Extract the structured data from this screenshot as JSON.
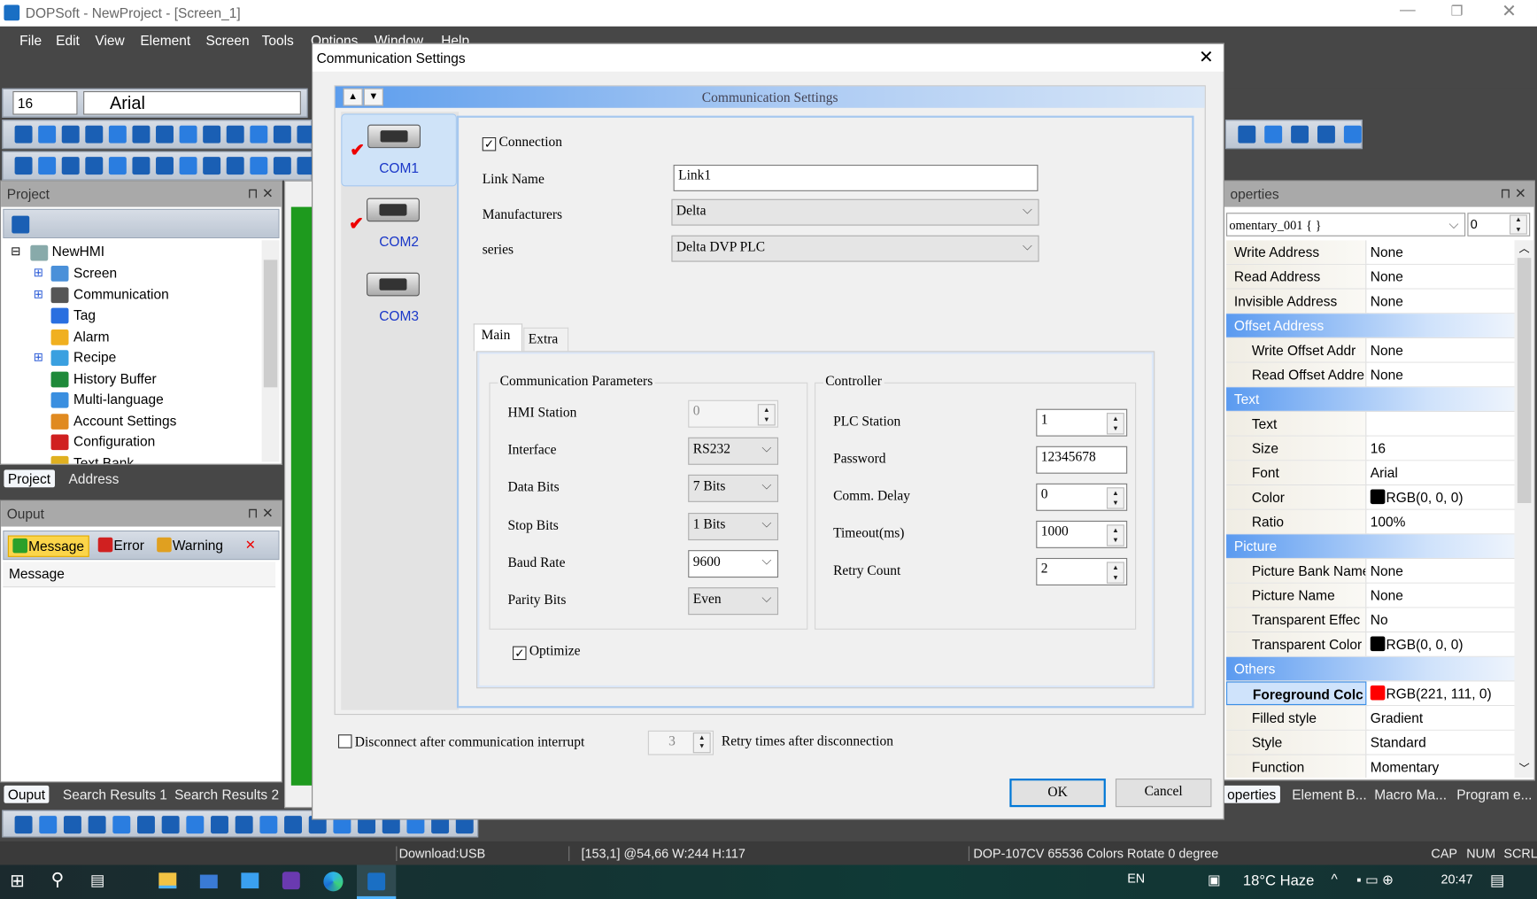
{
  "app": {
    "title": "DOPSoft - NewProject - [Screen_1]",
    "window_controls": [
      "minimize",
      "restore",
      "close"
    ]
  },
  "menu": [
    "File",
    "Edit",
    "View",
    "Element",
    "Screen",
    "Tools",
    "Options",
    "Window",
    "Help"
  ],
  "font_toolbar": {
    "size": "16",
    "font": "Arial"
  },
  "project_panel": {
    "title": "Project",
    "tree_root": "NewHMI",
    "tree": [
      {
        "label": "Screen",
        "expandable": true,
        "icon": "screen-icon",
        "color": "#4a90d9"
      },
      {
        "label": "Communication",
        "expandable": true,
        "icon": "communication-icon",
        "color": "#555555"
      },
      {
        "label": "Tag",
        "expandable": false,
        "icon": "tag-icon",
        "color": "#2a6fe0"
      },
      {
        "label": "Alarm",
        "expandable": false,
        "icon": "alarm-icon",
        "color": "#f0b020"
      },
      {
        "label": "Recipe",
        "expandable": true,
        "icon": "recipe-icon",
        "color": "#3aa0e0"
      },
      {
        "label": "History Buffer",
        "expandable": false,
        "icon": "history-buffer-icon",
        "color": "#1e8a3a"
      },
      {
        "label": "Multi-language",
        "expandable": false,
        "icon": "globe-icon",
        "color": "#3a8fe0"
      },
      {
        "label": "Account Settings",
        "expandable": false,
        "icon": "users-icon",
        "color": "#e08a20"
      },
      {
        "label": "Configuration",
        "expandable": false,
        "icon": "tools-icon",
        "color": "#d02020"
      },
      {
        "label": "Text Bank",
        "expandable": false,
        "icon": "text-bank-icon",
        "color": "#e0b020"
      }
    ],
    "tabs": [
      "Project",
      "Address"
    ]
  },
  "output_panel": {
    "title": "Ouput",
    "filters": [
      "Message",
      "Error",
      "Warning"
    ],
    "column": "Message",
    "tabs": [
      "Ouput",
      "Search Results 1",
      "Search Results 2"
    ]
  },
  "dialog": {
    "title": "Communication Settings",
    "header": "Communication Settings",
    "ports": [
      {
        "name": "COM1",
        "checked": true,
        "selected": true
      },
      {
        "name": "COM2",
        "checked": true,
        "selected": false
      },
      {
        "name": "COM3",
        "checked": false,
        "selected": false
      }
    ],
    "connection_label": "Connection",
    "connection_checked": true,
    "link_name_label": "Link Name",
    "link_name": "Link1",
    "manufacturers_label": "Manufacturers",
    "manufacturer": "Delta",
    "series_label": "series",
    "series": "Delta DVP PLC",
    "tabs": [
      "Main",
      "Extra"
    ],
    "active_tab": "Main",
    "comm_params": {
      "legend": "Communication Parameters",
      "rows": [
        {
          "label": "HMI Station",
          "value": "0",
          "kind": "spin-disabled"
        },
        {
          "label": "Interface",
          "value": "RS232",
          "kind": "select"
        },
        {
          "label": "Data Bits",
          "value": "7 Bits",
          "kind": "select"
        },
        {
          "label": "Stop Bits",
          "value": "1 Bits",
          "kind": "select"
        },
        {
          "label": "Baud Rate",
          "value": "9600",
          "kind": "select-white"
        },
        {
          "label": "Parity Bits",
          "value": "Even",
          "kind": "select"
        }
      ]
    },
    "controller": {
      "legend": "Controller",
      "rows": [
        {
          "label": "PLC Station",
          "value": "1",
          "kind": "spin"
        },
        {
          "label": "Password",
          "value": "12345678",
          "kind": "text"
        },
        {
          "label": "Comm. Delay",
          "value": "0",
          "kind": "spin"
        },
        {
          "label": "Timeout(ms)",
          "value": "1000",
          "kind": "spin"
        },
        {
          "label": "Retry Count",
          "value": "2",
          "kind": "spin"
        }
      ]
    },
    "optimize_label": "Optimize",
    "optimize_checked": true,
    "disconnect_label": "Disconnect after communication interrupt",
    "disconnect_checked": false,
    "retry_times": "3",
    "retry_label": "Retry times after disconnection",
    "ok": "OK",
    "cancel": "Cancel"
  },
  "properties": {
    "title": "operties",
    "object": "omentary_001 { }",
    "index": "0",
    "rows": [
      {
        "k": "Write Address",
        "v": "None"
      },
      {
        "k": "Read Address",
        "v": "None"
      },
      {
        "k": "Invisible Address",
        "v": "None"
      },
      {
        "cat": "Offset Address"
      },
      {
        "k": "Write Offset Addr",
        "v": "None",
        "indent": true
      },
      {
        "k": "Read Offset Addre",
        "v": "None",
        "indent": true
      },
      {
        "cat": "Text"
      },
      {
        "k": "Text",
        "v": "",
        "indent": true
      },
      {
        "k": "Size",
        "v": "16",
        "indent": true
      },
      {
        "k": "Font",
        "v": "Arial",
        "indent": true
      },
      {
        "k": "Color",
        "v": "RGB(0, 0, 0)",
        "swatch": "#000000",
        "indent": true
      },
      {
        "k": "Ratio",
        "v": "100%",
        "indent": true
      },
      {
        "cat": "Picture"
      },
      {
        "k": "Picture Bank Name",
        "v": "None",
        "indent": true
      },
      {
        "k": "Picture Name",
        "v": "None",
        "indent": true
      },
      {
        "k": "Transparent Effec",
        "v": "No",
        "indent": true
      },
      {
        "k": "Transparent Color",
        "v": "RGB(0, 0, 0)",
        "swatch": "#000000",
        "indent": true
      },
      {
        "cat": "Others"
      },
      {
        "k": "Foreground Colc",
        "v": "RGB(221, 111, 0)",
        "swatch": "#ff0000",
        "indent": true,
        "selected": true
      },
      {
        "k": "Filled style",
        "v": "Gradient",
        "indent": true
      },
      {
        "k": "Style",
        "v": "Standard",
        "indent": true
      },
      {
        "k": "Function",
        "v": "Momentary",
        "indent": true
      }
    ],
    "tabs": [
      "operties",
      "Element B...",
      "Macro Ma...",
      "Program e..."
    ]
  },
  "status": {
    "download": "Download:USB",
    "coords": "[153,1] @54,66 W:244 H:117",
    "model": "DOP-107CV 65536 Colors Rotate 0 degree",
    "indicators": [
      "CAP",
      "NUM",
      "SCRL"
    ]
  },
  "taskbar": {
    "lang": "EN",
    "weather": "18°C  Haze",
    "time": "20:47"
  }
}
